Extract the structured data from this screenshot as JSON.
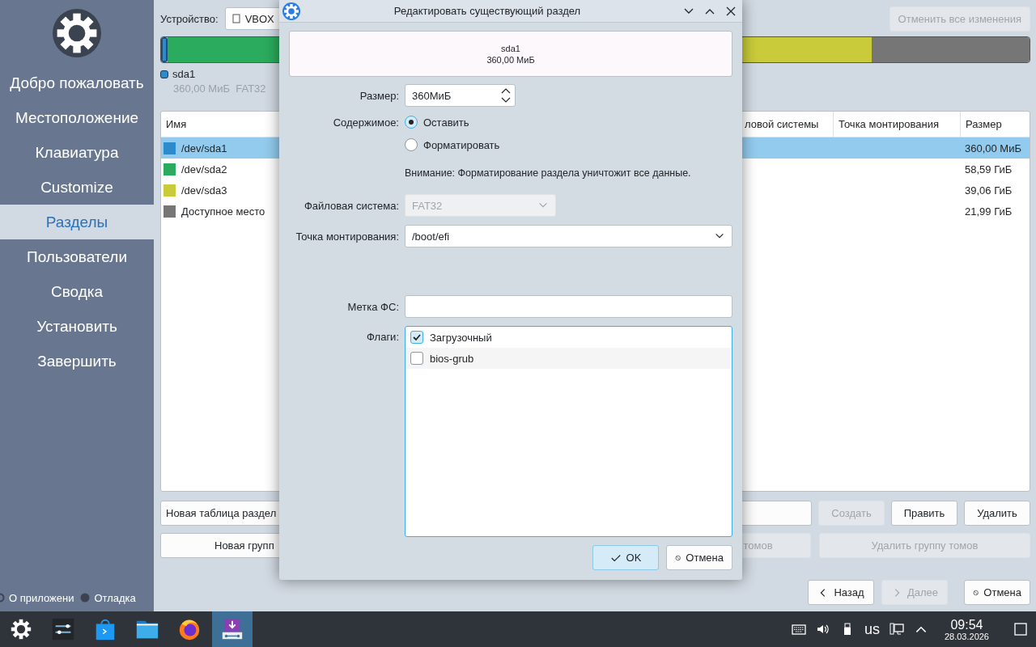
{
  "sidebar": {
    "items": [
      {
        "label": "Добро пожаловать",
        "selected": false
      },
      {
        "label": "Местоположение",
        "selected": false
      },
      {
        "label": "Клавиатура",
        "selected": false
      },
      {
        "label": "Customize",
        "selected": false
      },
      {
        "label": "Разделы",
        "selected": true
      },
      {
        "label": "Пользователи",
        "selected": false
      },
      {
        "label": "Сводка",
        "selected": false
      },
      {
        "label": "Установить",
        "selected": false
      },
      {
        "label": "Завершить",
        "selected": false
      }
    ],
    "footer": [
      {
        "label": "О приложени",
        "kind": "ring"
      },
      {
        "label": "Отладка",
        "kind": "dot"
      }
    ]
  },
  "device": {
    "label": "Устройство:",
    "value": "VBOX"
  },
  "revert_button": {
    "label": "Отменить все изменения",
    "disabled": true
  },
  "partition_bar": [
    {
      "color": "#2d8bcc",
      "selected": true
    },
    {
      "color": "#2bab5d",
      "selected": false
    },
    {
      "color": "#c9cb3a",
      "selected": false
    },
    {
      "color": "#767676",
      "selected": false
    }
  ],
  "legend": [
    {
      "name": "sda1",
      "details": "360,00 МиБ  FAT32",
      "color": "#2d8bcc"
    }
  ],
  "table": {
    "columns": [
      "Имя",
      "ловой системы",
      "Точка монтирования",
      "Размер"
    ],
    "rows": [
      {
        "name": "/dev/sda1",
        "color": "#2d8bcc",
        "size": "360,00 МиБ",
        "selected": true
      },
      {
        "name": "/dev/sda2",
        "color": "#2bab5d",
        "size": "58,59 ГиБ",
        "selected": false
      },
      {
        "name": "/dev/sda3",
        "color": "#c9cb3a",
        "size": "39,06 ГиБ",
        "selected": false
      },
      {
        "name": "Доступное место",
        "color": "#767676",
        "size": "21,99 ГиБ",
        "selected": false
      }
    ]
  },
  "partition_actions": [
    {
      "label": "Новая таблица раздел",
      "disabled": false
    },
    {
      "label": "Создать",
      "disabled": true
    },
    {
      "label": "Править",
      "disabled": false
    },
    {
      "label": "Удалить",
      "disabled": false
    }
  ],
  "volume_actions": [
    {
      "label": "Новая групп",
      "disabled": false
    },
    {
      "label": "томов",
      "disabled": true
    },
    {
      "label": "Удалить группу томов",
      "disabled": true
    }
  ],
  "nav_buttons": [
    {
      "label": "Назад",
      "kind": "back",
      "disabled": false
    },
    {
      "label": "Далее",
      "kind": "next",
      "disabled": true
    },
    {
      "label": "Отмена",
      "kind": "cancel",
      "disabled": false
    }
  ],
  "dialog": {
    "title": "Редактировать существующий раздел",
    "preview": {
      "name": "sda1",
      "size": "360,00 МиБ"
    },
    "size": {
      "label": "Размер:",
      "value": "360МиБ"
    },
    "content": {
      "label": "Содержимое:",
      "options": [
        {
          "label": "Оставить",
          "selected": true
        },
        {
          "label": "Форматировать",
          "selected": false
        }
      ]
    },
    "warning": "Внимание: Форматирование раздела уничтожит все данные.",
    "filesystem": {
      "label": "Файловая система:",
      "value": "FAT32",
      "disabled": true
    },
    "mount_point": {
      "label": "Точка монтирования:",
      "value": "/boot/efi"
    },
    "fs_label": {
      "label": "Метка ФС:"
    },
    "flags": {
      "label": "Флаги:",
      "items": [
        {
          "label": "Загрузочный",
          "checked": true
        },
        {
          "label": "bios-grub",
          "checked": false
        }
      ]
    },
    "buttons": [
      {
        "label": "OK",
        "kind": "ok",
        "focused": true
      },
      {
        "label": "Отмена",
        "kind": "cancel",
        "focused": false
      }
    ]
  },
  "taskbar": {
    "apps": [
      {
        "kind": "menu",
        "active": false
      },
      {
        "kind": "settings",
        "active": false
      },
      {
        "kind": "store",
        "active": false
      },
      {
        "kind": "files",
        "active": false
      },
      {
        "kind": "browser",
        "active": false
      },
      {
        "kind": "installer",
        "active": true
      }
    ],
    "layout": "us",
    "time": "09:54",
    "date": "28.03.2026"
  }
}
